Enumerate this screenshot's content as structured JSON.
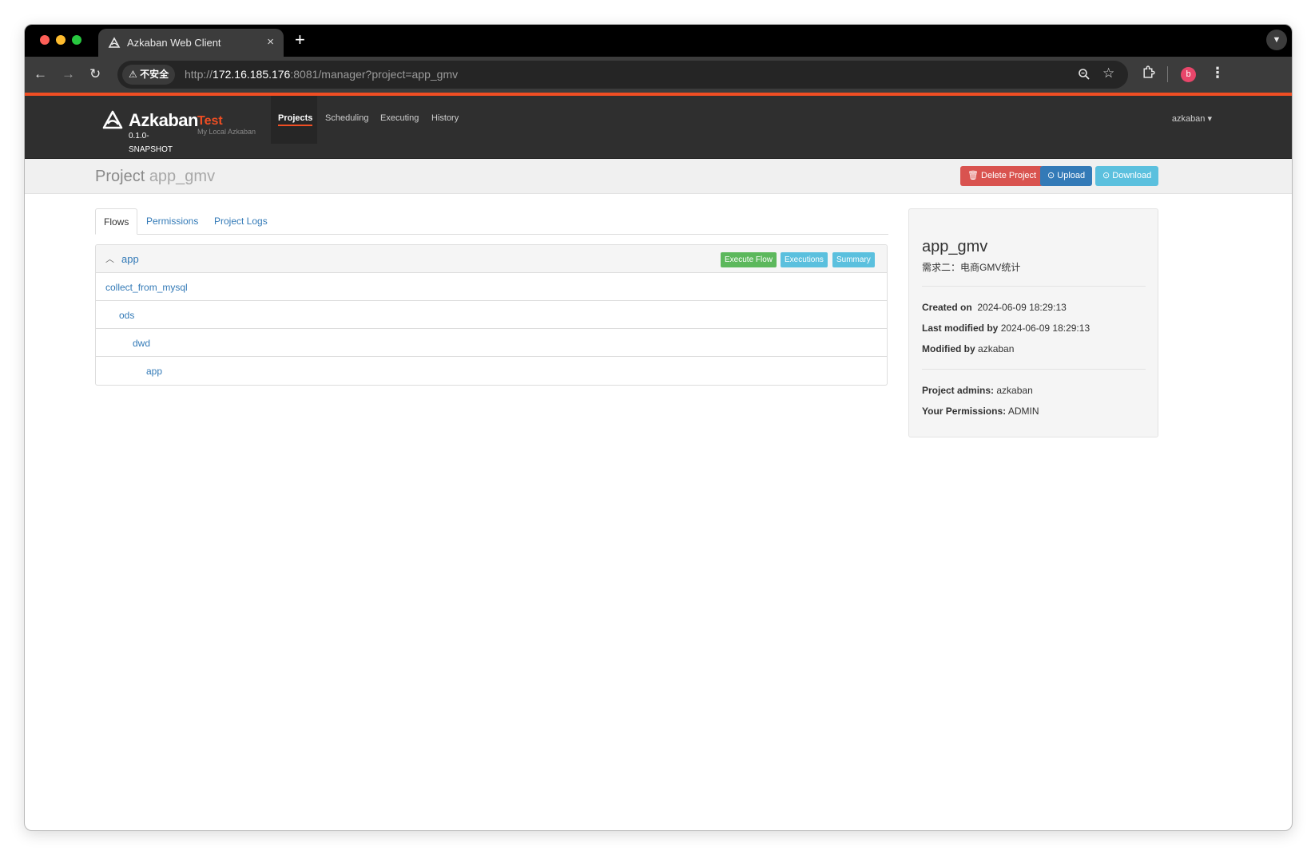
{
  "browser": {
    "tab_title": "Azkaban Web Client",
    "tab_close": "×",
    "new_tab": "+",
    "security_chip": "⚠ 不安全",
    "url_scheme": "http://",
    "url_host": "172.16.185.176",
    "url_rest": ":8081/manager?project=app_gmv",
    "profile_initial": "b"
  },
  "navbar": {
    "brand": "Azkaban",
    "version": "0.1.0-SNAPSHOT",
    "env_name": "Test",
    "env_desc": "My Local Azkaban",
    "items": [
      {
        "label": "Projects",
        "active": true
      },
      {
        "label": "Scheduling",
        "active": false
      },
      {
        "label": "Executing",
        "active": false
      },
      {
        "label": "History",
        "active": false
      }
    ],
    "user": "azkaban ▾"
  },
  "project_header": {
    "label": "Project",
    "name": "app_gmv",
    "buttons": {
      "delete": "🗑 Delete Project",
      "upload": "⊙ Upload",
      "download": "⊙ Download"
    }
  },
  "tabs": [
    {
      "label": "Flows",
      "active": true
    },
    {
      "label": "Permissions",
      "active": false
    },
    {
      "label": "Project Logs",
      "active": false
    }
  ],
  "flow": {
    "name": "app",
    "buttons": {
      "execute": "Execute Flow",
      "executions": "Executions",
      "summary": "Summary"
    },
    "jobs": [
      {
        "name": "collect_from_mysql",
        "level": 0
      },
      {
        "name": "ods",
        "level": 1
      },
      {
        "name": "dwd",
        "level": 2
      },
      {
        "name": "app",
        "level": 3
      }
    ]
  },
  "sidebar": {
    "project_name": "app_gmv",
    "description": "需求二：电商GMV统计",
    "created_label": "Created on",
    "created_value": "2024-06-09 18:29:13",
    "modified_label": "Last modified by",
    "modified_value": "2024-06-09 18:29:13",
    "modified_by_label": "Modified by",
    "modified_by_value": "azkaban",
    "admins_label": "Project admins:",
    "admins_value": "azkaban",
    "perm_label": "Your Permissions:",
    "perm_value": "ADMIN"
  },
  "colors": {
    "accent_orange": "#f04e23",
    "navbar_bg": "#2f2f2f",
    "link_blue": "#337ab7",
    "danger": "#d9534f",
    "primary": "#337ab7",
    "info": "#5bc0de",
    "success": "#5cb85c"
  }
}
